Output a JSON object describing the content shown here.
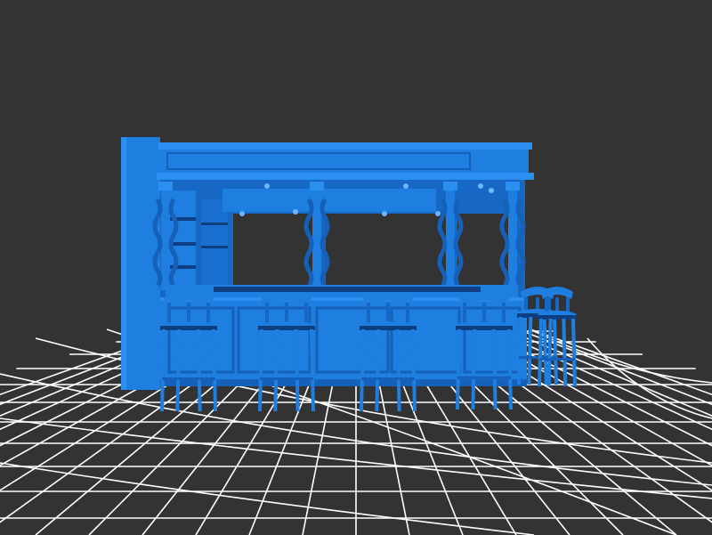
{
  "scene": {
    "background": "#333333",
    "model_color": "#1f7fe0",
    "model_shadow": "#1560b8",
    "model_dark": "#0d3f80",
    "grid_color": "#ffffff",
    "subject": "bar-counter-with-stools",
    "stool_count": 6,
    "pillar_count": 4
  }
}
